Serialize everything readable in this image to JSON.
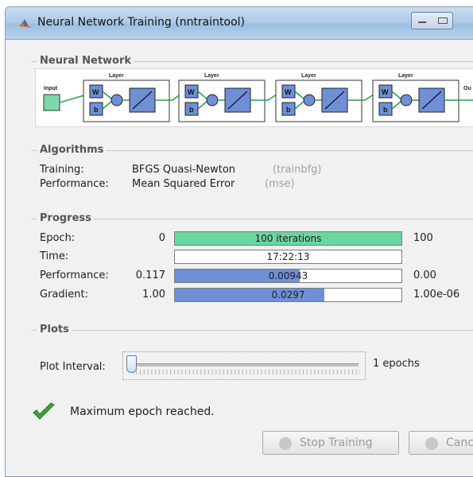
{
  "window": {
    "title": "Neural Network Training (nntraintool)"
  },
  "neural_network": {
    "heading": "Neural Network",
    "input_label": "Input",
    "output_label": "Ou",
    "layers": [
      {
        "label": "Layer",
        "w": "W",
        "b": "b"
      },
      {
        "label": "Layer",
        "w": "W",
        "b": "b"
      },
      {
        "label": "Layer",
        "w": "W",
        "b": "b"
      },
      {
        "label": "Layer",
        "w": "W",
        "b": "b"
      }
    ]
  },
  "algorithms": {
    "heading": "Algorithms",
    "training_label": "Training:",
    "training_value": "BFGS Quasi-Newton",
    "training_fn": "(trainbfg)",
    "performance_label": "Performance:",
    "performance_value": "Mean Squared Error",
    "performance_fn": "(mse)"
  },
  "progress": {
    "heading": "Progress",
    "rows": [
      {
        "label": "Epoch:",
        "start": "0",
        "bar_text": "100 iterations",
        "end": "100",
        "fill": 1.0,
        "color": "#6ad6a0"
      },
      {
        "label": "Time:",
        "start": "",
        "bar_text": "17:22:13",
        "end": "",
        "fill": 0.0,
        "color": "#ffffff"
      },
      {
        "label": "Performance:",
        "start": "0.117",
        "bar_text": "0.00943",
        "end": "0.00",
        "fill": 0.55,
        "color": "#6f8fd6"
      },
      {
        "label": "Gradient:",
        "start": "1.00",
        "bar_text": "0.0297",
        "end": "1.00e-06",
        "fill": 0.66,
        "color": "#6f8fd6"
      }
    ]
  },
  "plots": {
    "heading": "Plots",
    "interval_label": "Plot Interval:",
    "interval_value": "1 epochs",
    "slider_level": 0.0
  },
  "status": {
    "message": "Maximum epoch reached."
  },
  "buttons": {
    "stop_label": "Stop Training",
    "cancel_label": "Canc"
  }
}
